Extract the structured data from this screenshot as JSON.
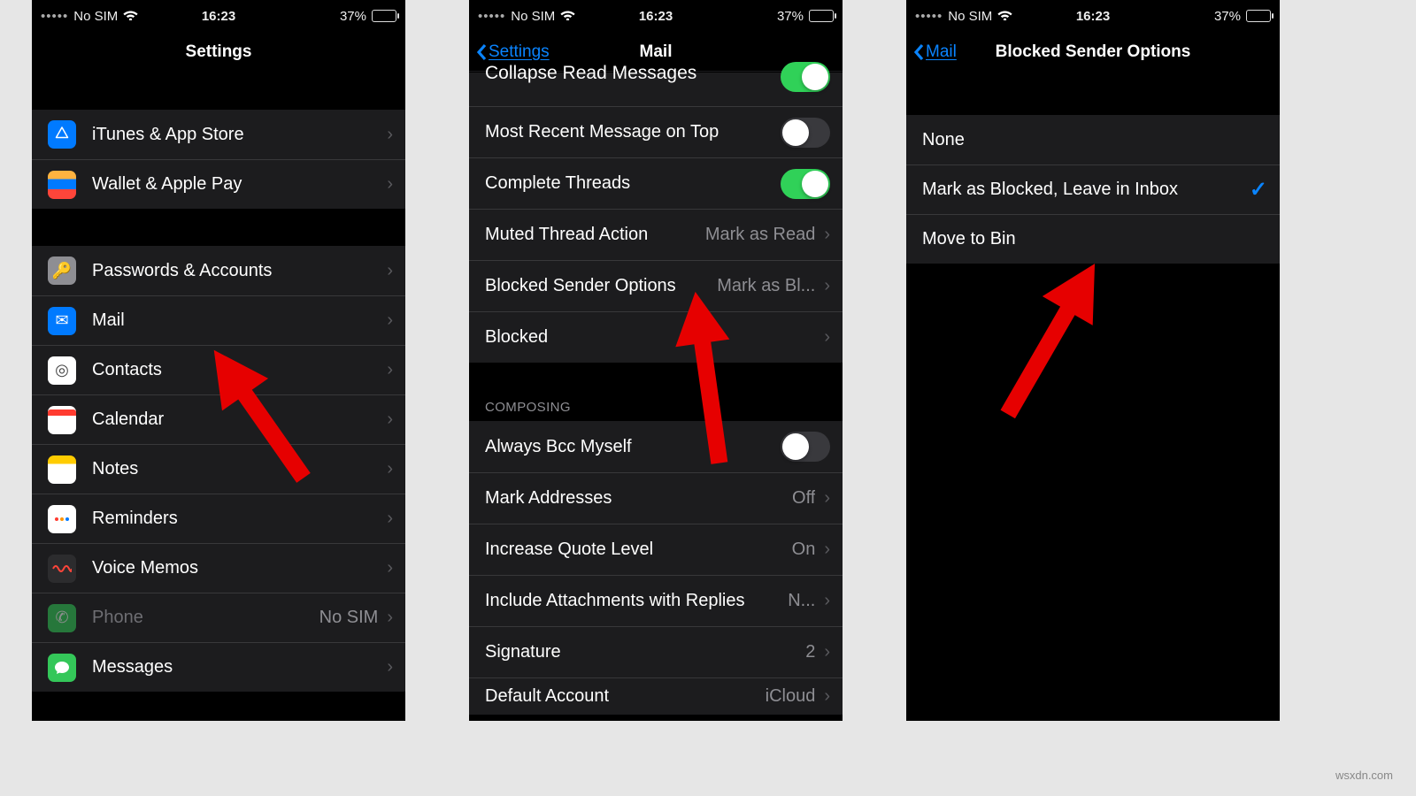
{
  "statusbar": {
    "carrier": "No SIM",
    "time": "16:23",
    "battery": "37%"
  },
  "screen1": {
    "title": "Settings",
    "rows_g1": [
      {
        "label": "iTunes & App Store"
      },
      {
        "label": "Wallet & Apple Pay"
      }
    ],
    "rows_g2": [
      {
        "label": "Passwords & Accounts"
      },
      {
        "label": "Mail"
      },
      {
        "label": "Contacts"
      },
      {
        "label": "Calendar"
      },
      {
        "label": "Notes"
      },
      {
        "label": "Reminders"
      },
      {
        "label": "Voice Memos"
      },
      {
        "label": "Phone",
        "detail": "No SIM",
        "dim": true
      },
      {
        "label": "Messages"
      }
    ]
  },
  "screen2": {
    "back": "Settings",
    "title": "Mail",
    "header": "COMPOSING",
    "rows_top": [
      {
        "label": "Collapse Read Messages",
        "toggle": "on"
      },
      {
        "label": "Most Recent Message on Top",
        "toggle": "off"
      },
      {
        "label": "Complete Threads",
        "toggle": "on"
      },
      {
        "label": "Muted Thread Action",
        "detail": "Mark as Read"
      },
      {
        "label": "Blocked Sender Options",
        "detail": "Mark as Bl..."
      },
      {
        "label": "Blocked"
      }
    ],
    "rows_compose": [
      {
        "label": "Always Bcc Myself",
        "toggle": "off"
      },
      {
        "label": "Mark Addresses",
        "detail": "Off"
      },
      {
        "label": "Increase Quote Level",
        "detail": "On"
      },
      {
        "label": "Include Attachments with Replies",
        "detail": "N..."
      },
      {
        "label": "Signature",
        "detail": "2"
      },
      {
        "label": "Default Account",
        "detail": "iCloud"
      }
    ]
  },
  "screen3": {
    "back": "Mail",
    "title": "Blocked Sender Options",
    "options": [
      {
        "label": "None"
      },
      {
        "label": "Mark as Blocked, Leave in Inbox",
        "selected": true
      },
      {
        "label": "Move to Bin"
      }
    ]
  },
  "watermark": "wsxdn.com"
}
